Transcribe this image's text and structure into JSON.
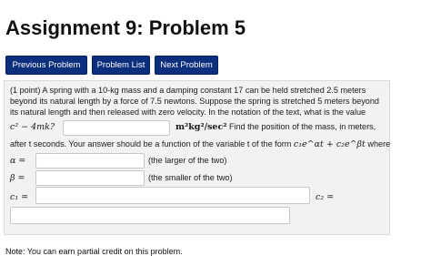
{
  "page": {
    "title": "Assignment 9: Problem 5"
  },
  "nav": {
    "previous_label": "Previous Problem",
    "list_label": "Problem List",
    "next_label": "Next Problem"
  },
  "problem": {
    "text": "(1 point) A spring with a 10-kg mass and a damping constant 17 can be held stretched 2.5 meters beyond its natural length by a force of 7.5 newtons. Suppose the spring is stretched 5 meters beyond its natural length and then released with zero velocity. In the notation of the text, what is the value",
    "expr_label": "c² − 4mk?",
    "units_label": "m²kg²/sec²",
    "find_text": "Find the position of the mass, in meters,",
    "after_text": "after t seconds. Your answer should be a function of the variable t of the form",
    "form_expr": "c₁e^αt + c₂e^βt",
    "where_text": "where",
    "alpha_label": "α =",
    "alpha_hint": "(the larger of the two)",
    "beta_label": "β =",
    "beta_hint": "(the smaller of the two)",
    "c1_label": "c₁ =",
    "c2_label": "c₂ ="
  },
  "inputs": {
    "expr_value": "",
    "alpha_value": "",
    "beta_value": "",
    "c1_value": "",
    "c2_value": ""
  },
  "footer": {
    "note": "Note: You can earn partial credit on this problem."
  },
  "colors": {
    "button_bg": "#0b2e7d",
    "panel_bg": "#f2f2f2"
  }
}
